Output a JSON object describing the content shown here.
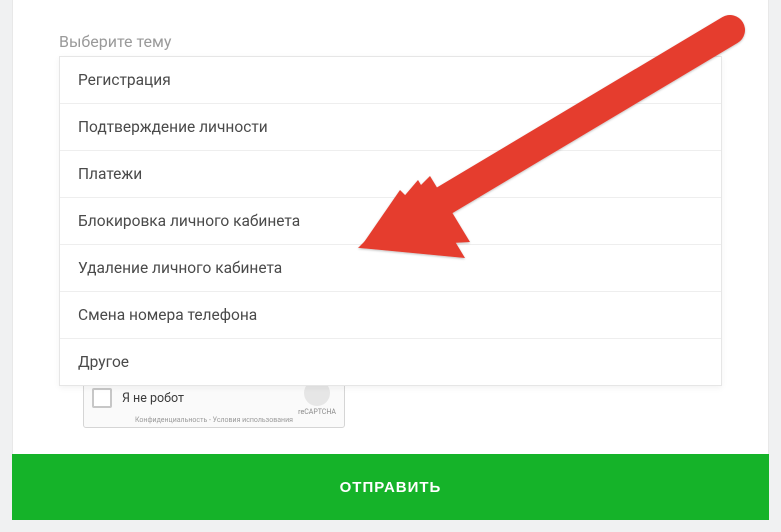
{
  "select": {
    "label": "Выберите тему",
    "options": [
      "Регистрация",
      "Подтверждение личности",
      "Платежи",
      "Блокировка личного кабинета",
      "Удаление личного кабинета",
      "Смена номера телефона",
      "Другое"
    ]
  },
  "recaptcha": {
    "label": "Я не робот",
    "brand": "reCAPTCHA",
    "footer": "Конфиденциальность - Условия использования"
  },
  "submit_label": "ОТПРАВИТЬ",
  "colors": {
    "accent": "#15b329",
    "arrow": "#e53d2f"
  }
}
